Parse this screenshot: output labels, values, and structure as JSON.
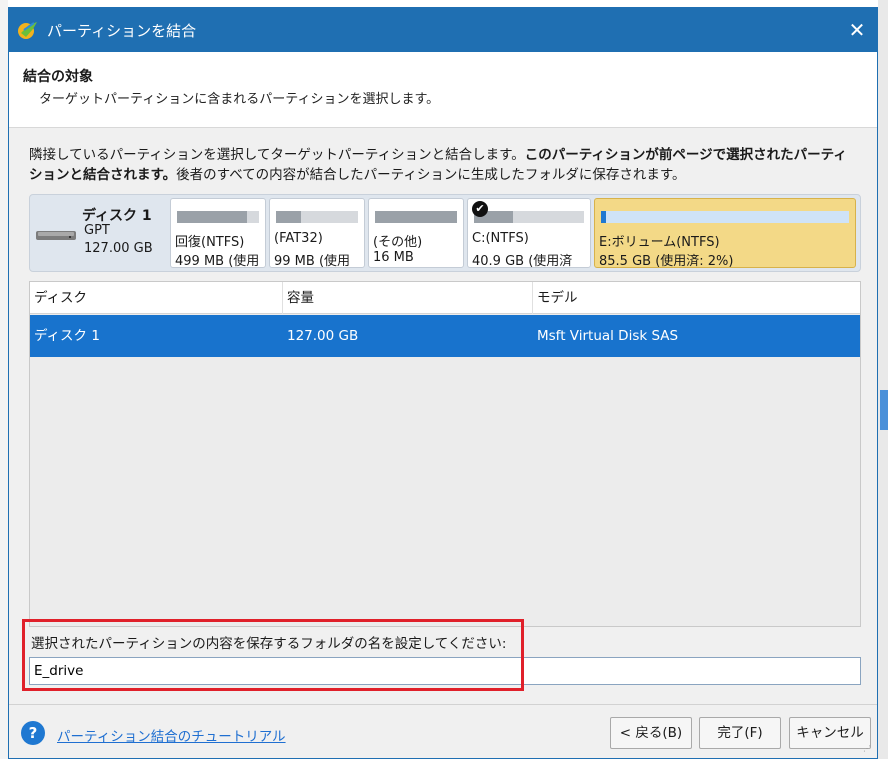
{
  "window": {
    "title": "パーティションを結合",
    "close_icon": "close-icon"
  },
  "header": {
    "title": "結合の対象",
    "subtitle": "ターゲットパーティションに含まれるパーティションを選択します。"
  },
  "description": {
    "part1": "隣接しているパーティションを選択してターゲットパーティションと結合します。",
    "bold": "このパーティションが前ページで選択されたパーティションと結合されます。",
    "part2": "後者のすべての内容が結合したパーティションに生成したフォルダに保存されます。"
  },
  "disk_map": {
    "disk_name": "ディスク 1",
    "disk_type": "GPT",
    "disk_size": "127.00 GB",
    "partitions": [
      {
        "name": "回復(NTFS)",
        "size": "499 MB (使用",
        "used_fraction": 0.85,
        "selected": false,
        "checked": false
      },
      {
        "name": "(FAT32)",
        "size": "99 MB (使用",
        "used_fraction": 0.3,
        "selected": false,
        "checked": false
      },
      {
        "name": "(その他)",
        "size": "16 MB",
        "used_fraction": 1.0,
        "selected": false,
        "checked": false
      },
      {
        "name": "C:(NTFS)",
        "size": "40.9 GB (使用済",
        "used_fraction": 0.35,
        "selected": false,
        "checked": true
      },
      {
        "name": "E:ボリューム(NTFS)",
        "size": "85.5 GB (使用済: 2%)",
        "used_fraction": 0.02,
        "selected": true,
        "checked": false
      }
    ]
  },
  "table": {
    "columns": [
      "ディスク",
      "容量",
      "モデル"
    ],
    "rows": [
      {
        "disk": "ディスク 1",
        "capacity": "127.00 GB",
        "model": "Msft Virtual Disk SAS"
      }
    ]
  },
  "folder": {
    "label": "選択されたパーティションの内容を保存するフォルダの名を設定してください:",
    "value": "E_drive"
  },
  "footer": {
    "tutorial_link": "パーティション結合のチュートリアル",
    "back_button": "< 戻る(B)",
    "finish_button": "完了(F)",
    "cancel_button": "キャンセル"
  },
  "colors": {
    "titlebar": "#1f6fb2",
    "selected_row": "#1873cd",
    "selected_partition": "#f3d987",
    "highlight_box": "#e0202a",
    "link": "#1f6fd1"
  }
}
